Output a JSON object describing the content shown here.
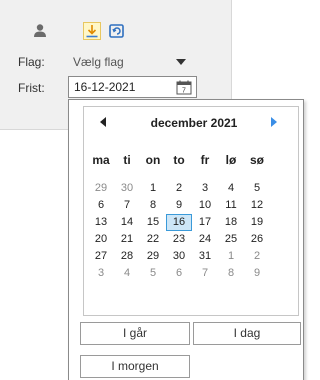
{
  "toolbar": {
    "icons": [
      "person-icon",
      "download-icon",
      "sync-icon"
    ],
    "accent_color": "#e8b400"
  },
  "fields": {
    "flag_label": "Flag:",
    "flag_value": "Vælg flag",
    "due_label": "Frist:",
    "due_value": "16-12-2021"
  },
  "calendar": {
    "month_title": "december 2021",
    "weekdays": [
      "ma",
      "ti",
      "on",
      "to",
      "fr",
      "lø",
      "sø"
    ],
    "weeks": [
      [
        "29",
        "30",
        "1",
        "2",
        "3",
        "4",
        "5"
      ],
      [
        "6",
        "7",
        "8",
        "9",
        "10",
        "11",
        "12"
      ],
      [
        "13",
        "14",
        "15",
        "16",
        "17",
        "18",
        "19"
      ],
      [
        "20",
        "21",
        "22",
        "23",
        "24",
        "25",
        "26"
      ],
      [
        "27",
        "28",
        "29",
        "30",
        "31",
        "1",
        "2"
      ],
      [
        "3",
        "4",
        "5",
        "6",
        "7",
        "8",
        "9"
      ]
    ],
    "selected_day": "16",
    "selection_color": "#cde6f7",
    "nav_arrow_color": "#3a8ee6"
  },
  "quick_buttons": {
    "yesterday": "I går",
    "today": "I dag",
    "tomorrow": "I morgen"
  }
}
